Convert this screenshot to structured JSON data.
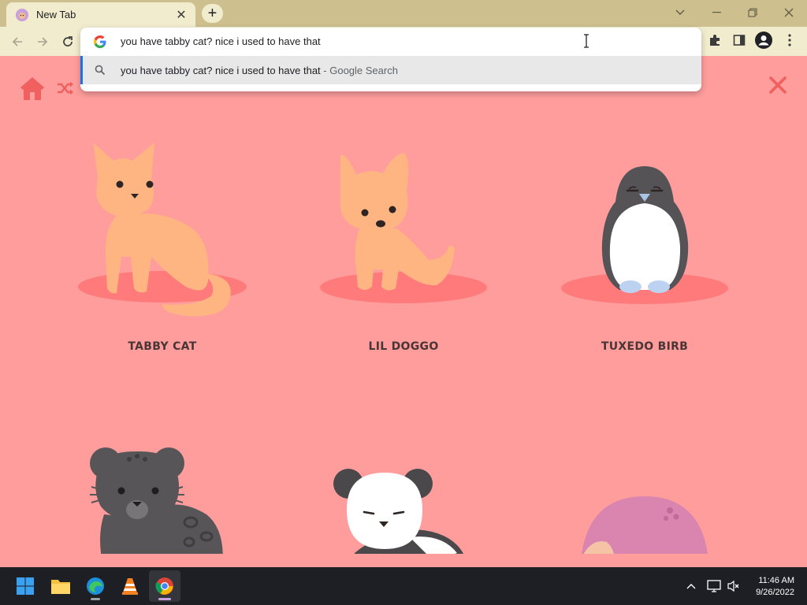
{
  "browser": {
    "tab": {
      "title": "New Tab"
    },
    "new_tab_symbol": "+",
    "window_controls": {
      "dropdown": "⌄",
      "minimize": "—",
      "restore": "❐",
      "close": "✕"
    },
    "omnibox": {
      "value": "you have tabby cat? nice i used to have that",
      "suggestion": {
        "query": "you have tabby cat? nice i used to have that",
        "suffix": " - Google Search"
      }
    }
  },
  "page": {
    "background": "#ff9d9d",
    "accent": "#f0605f",
    "pets": [
      {
        "label": "TABBY CAT"
      },
      {
        "label": "LIL DOGGO"
      },
      {
        "label": "TUXEDO BIRB"
      }
    ]
  },
  "taskbar": {
    "apps": [
      "windows-start",
      "file-explorer",
      "edge",
      "vlc",
      "chrome"
    ],
    "clock": {
      "time": "11:46 AM",
      "date": "9/26/2022"
    }
  }
}
